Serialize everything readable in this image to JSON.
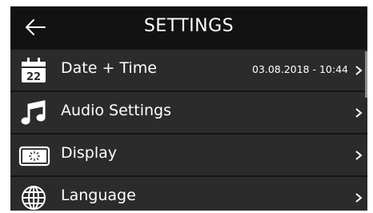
{
  "header": {
    "title": "SETTINGS",
    "back_icon": "back-arrow-icon"
  },
  "menu": {
    "items": [
      {
        "label": "Date + Time",
        "value": "03.08.2018 - 10:44",
        "icon": "calendar-icon",
        "icon_text": "22"
      },
      {
        "label": "Audio Settings",
        "value": "",
        "icon": "music-note-icon"
      },
      {
        "label": "Display",
        "value": "",
        "icon": "display-icon"
      },
      {
        "label": "Language",
        "value": "",
        "icon": "globe-icon"
      }
    ]
  },
  "colors": {
    "background": "#2b2b2b",
    "header": "#121212",
    "text": "#ffffff",
    "divider": "#141414"
  }
}
